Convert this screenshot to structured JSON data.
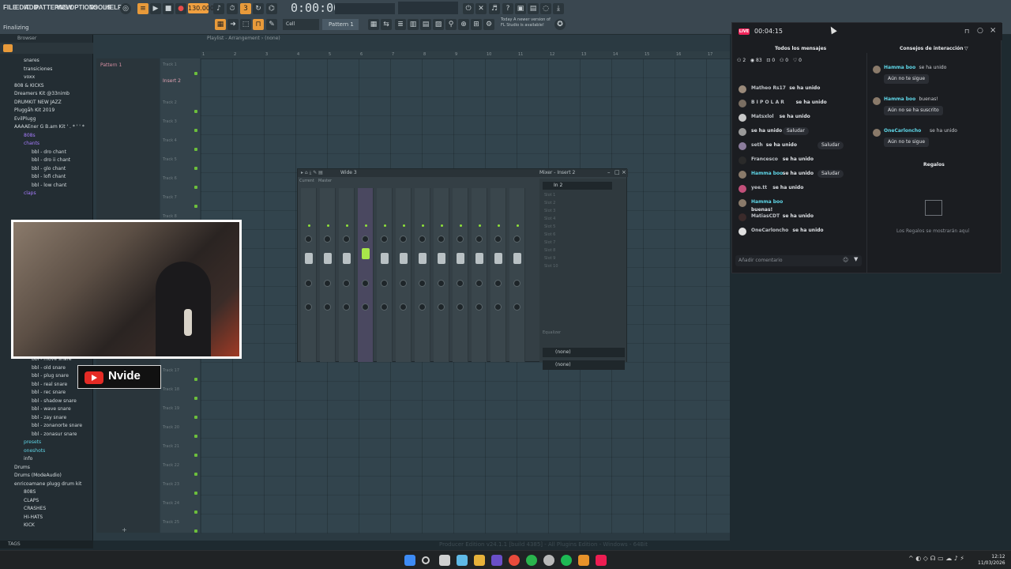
{
  "menu": {
    "items": [
      "FILE",
      "EDIT",
      "ADD",
      "PATTERNS",
      "VIEW",
      "OPTIONS",
      "TOOLS",
      "HELP"
    ]
  },
  "status_text": "Finalizing",
  "transport": {
    "tempo": "130.000",
    "time": "0:00:00"
  },
  "news": {
    "line1": "Today  A newer version of",
    "line2": "FL Studio is available!"
  },
  "toolbar2": {
    "pattern_label": "Pattern 1",
    "snap_label": "Cell"
  },
  "playlist": {
    "title": "Playlist - Arrangement › (none)",
    "ruler": [
      "1",
      "2",
      "3",
      "4",
      "5",
      "6",
      "7",
      "8",
      "9",
      "10",
      "11",
      "12",
      "13",
      "14",
      "15",
      "16",
      "17"
    ],
    "pattern": "Pattern 1",
    "insert": "Insert 2",
    "tracks": [
      "Track 1",
      "Track 2",
      "Track 3",
      "Track 4",
      "Track 5",
      "Track 6",
      "Track 7",
      "Track 8",
      "Track 17",
      "Track 18",
      "Track 19",
      "Track 20",
      "Track 21",
      "Track 22",
      "Track 23",
      "Track 24",
      "Track 25"
    ],
    "footer": "Producer Edition v24.1.1 [build 4385] - All Plugins Edition - Windows - 64Bit"
  },
  "browser": {
    "header": "Browser",
    "items_top": [
      {
        "label": "snares",
        "cls": "br-folder",
        "indent": 30
      },
      {
        "label": "transiciones",
        "cls": "br-folder",
        "indent": 30
      },
      {
        "label": "voxx",
        "cls": "br-folder",
        "indent": 30
      },
      {
        "label": "808 & KICKS",
        "cls": "br-folder",
        "indent": 18
      },
      {
        "label": "Dreamers Kit @33nimb",
        "cls": "br-folder",
        "indent": 18
      },
      {
        "label": "DRUMKIT NEW JAZZ",
        "cls": "br-folder",
        "indent": 18
      },
      {
        "label": "Pluggåh Kit 2019",
        "cls": "br-folder",
        "indent": 18
      },
      {
        "label": "EvilPlugg",
        "cls": "br-folder",
        "indent": 18
      },
      {
        "label": "AAAAEner G B.am Kit ' . * ' ' *",
        "cls": "br-folder",
        "indent": 18
      },
      {
        "label": "808s",
        "cls": "br-purple",
        "indent": 30
      },
      {
        "label": "chants",
        "cls": "br-purple",
        "indent": 30
      },
      {
        "label": "bbl - dro chant",
        "cls": "",
        "indent": 40
      },
      {
        "label": "bbl - dro ii chant",
        "cls": "",
        "indent": 40
      },
      {
        "label": "bbl - glo chant",
        "cls": "",
        "indent": 40
      },
      {
        "label": "bbl - lofi chant",
        "cls": "",
        "indent": 40
      },
      {
        "label": "bbl - low chant",
        "cls": "",
        "indent": 40
      },
      {
        "label": "claps",
        "cls": "br-purple",
        "indent": 30
      }
    ],
    "items_bottom": [
      {
        "label": "bbl - move snare",
        "cls": "",
        "indent": 40
      },
      {
        "label": "bbl - old snare",
        "cls": "",
        "indent": 40
      },
      {
        "label": "bbl - plug snare",
        "cls": "",
        "indent": 40
      },
      {
        "label": "bbl - real snare",
        "cls": "",
        "indent": 40
      },
      {
        "label": "bbl - rec snare",
        "cls": "",
        "indent": 40
      },
      {
        "label": "bbl - shadow snare",
        "cls": "",
        "indent": 40
      },
      {
        "label": "bbl - wave snare",
        "cls": "",
        "indent": 40
      },
      {
        "label": "bbl - zay snare",
        "cls": "",
        "indent": 40
      },
      {
        "label": "bbl - zonanorte snare",
        "cls": "",
        "indent": 40
      },
      {
        "label": "bbl - zonasur snare",
        "cls": "",
        "indent": 40
      },
      {
        "label": "presets",
        "cls": "br-teal",
        "indent": 30
      },
      {
        "label": "oneshots",
        "cls": "br-teal",
        "indent": 30
      },
      {
        "label": "info",
        "cls": "",
        "indent": 30
      },
      {
        "label": "Drums",
        "cls": "br-folder",
        "indent": 18
      },
      {
        "label": "Drums (ModeAudio)",
        "cls": "br-folder",
        "indent": 18
      },
      {
        "label": "enricoamane plugg drum kit",
        "cls": "br-folder",
        "indent": 18
      },
      {
        "label": "808S",
        "cls": "br-folder",
        "indent": 30
      },
      {
        "label": "CLAPS",
        "cls": "br-folder",
        "indent": 30
      },
      {
        "label": "CRASHES",
        "cls": "br-folder",
        "indent": 30
      },
      {
        "label": "HI-HATS",
        "cls": "br-folder",
        "indent": 30
      },
      {
        "label": "KICK",
        "cls": "br-folder",
        "indent": 30
      }
    ],
    "tags": "TAGS"
  },
  "mixer": {
    "title": "Mixer - Insert 2",
    "preset": "Wide 3",
    "strip_labels": [
      "Current",
      "Master"
    ],
    "insert_in": "In 2",
    "out_none_1": "(none)",
    "out_none_2": "(none)",
    "slot_labels": [
      "Slot 1",
      "Slot 2",
      "Slot 3",
      "Slot 4",
      "Slot 5",
      "Slot 6",
      "Slot 7",
      "Slot 8",
      "Slot 9",
      "Slot 10"
    ],
    "equalizer": "Equalizer"
  },
  "webcam": {
    "channel_name": "Nvide"
  },
  "chat": {
    "live_label": "LIVE",
    "live_time": "00:04:15",
    "col_messages": "Todos los mensajes",
    "col_tips": "Consejos de interacción",
    "stats": {
      "viewers": "2",
      "views": "83",
      "gifts": "0",
      "shares": "0",
      "likes": "0"
    },
    "messages": [
      {
        "name": "Matheo Rs17",
        "text": "se ha unido",
        "greet": "",
        "color": "#9a8a7a"
      },
      {
        "name": "B I P O L A R",
        "text": "se ha unido",
        "greet": "",
        "color": "#7a6e62"
      },
      {
        "name": "Matsxlol",
        "text": "se ha unido",
        "greet": "",
        "color": "#c8c8c8"
      },
      {
        "name": "",
        "text": "se ha unido",
        "greet": "Saludar",
        "color": "#9a9a9a"
      },
      {
        "name": "seth",
        "text": "se ha unido",
        "greet": "Saludar",
        "color": "#8b7c9c"
      },
      {
        "name": "Francesco",
        "text": "se ha unido",
        "greet": "",
        "color": "#2a2a2a"
      },
      {
        "name": "Hamma boo",
        "text": "se ha unido",
        "greet": "Saludar",
        "color": "#8a7a6a"
      },
      {
        "name": "yee.tt",
        "text": "se ha unido",
        "greet": "",
        "color": "#c2507a"
      },
      {
        "name": "Hamma boo",
        "text": "buenas!",
        "greet": "",
        "color": "#8a7a6a"
      },
      {
        "name": "MatiasCDT",
        "text": "se ha unido",
        "greet": "",
        "color": "#3a2a2a"
      },
      {
        "name": "OneCarloncho",
        "text": "se ha unido",
        "greet": "",
        "color": "#e0e0e0"
      }
    ],
    "comment_placeholder": "Añadir comentario",
    "tips": [
      {
        "name": "Hamma boo",
        "text": "se ha unido",
        "button": "Aún no te sigue"
      },
      {
        "name": "Hamma boo",
        "text": "buenas!",
        "button": "Aún no se ha suscrito"
      },
      {
        "name": "OneCarloncho",
        "text": "se ha unido",
        "button": "Aún no te sigue"
      }
    ],
    "gifts_title": "Regalos",
    "gifts_empty": "Los Regalos se mostrarán aquí"
  },
  "taskbar": {
    "time": "12:12",
    "date": "11/03/2026"
  }
}
